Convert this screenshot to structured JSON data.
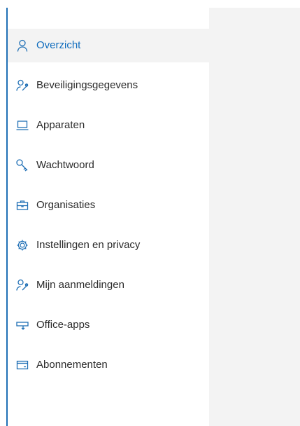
{
  "sidebar": {
    "items": [
      {
        "label": "Overzicht",
        "icon": "person-icon",
        "selected": true
      },
      {
        "label": "Beveiligingsgegevens",
        "icon": "person-key-icon",
        "selected": false
      },
      {
        "label": "Apparaten",
        "icon": "laptop-icon",
        "selected": false
      },
      {
        "label": "Wachtwoord",
        "icon": "key-icon",
        "selected": false
      },
      {
        "label": "Organisaties",
        "icon": "briefcase-icon",
        "selected": false
      },
      {
        "label": "Instellingen en privacy",
        "icon": "gear-icon",
        "selected": false
      },
      {
        "label": "Mijn aanmeldingen",
        "icon": "person-key-icon",
        "selected": false
      },
      {
        "label": "Office-apps",
        "icon": "office-apps-icon",
        "selected": false
      },
      {
        "label": "Abonnementen",
        "icon": "card-icon",
        "selected": false
      }
    ]
  },
  "colors": {
    "accent": "#1f6fb5",
    "selected_background": "#f3f3f3",
    "main_background": "#f3f3f3",
    "text": "#2b2b2b"
  }
}
